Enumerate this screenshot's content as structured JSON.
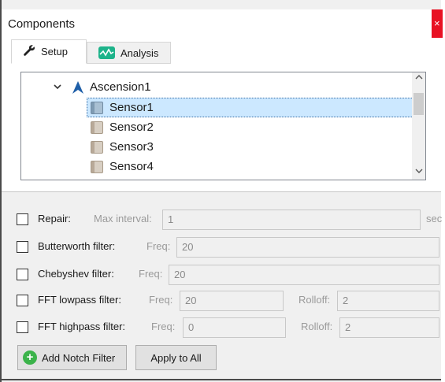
{
  "window": {
    "title": "Components",
    "close_glyph": "×"
  },
  "tabs": [
    {
      "label": "Setup",
      "icon": "wrench-icon",
      "selected": true
    },
    {
      "label": "Analysis",
      "icon": "analysis-chart-icon",
      "selected": false
    }
  ],
  "tree": {
    "root": {
      "label": "Ascension1",
      "expanded": true,
      "icon": "ascension-arrow-icon"
    },
    "items": [
      {
        "label": "Sensor1",
        "selected": true
      },
      {
        "label": "Sensor2",
        "selected": false
      },
      {
        "label": "Sensor3",
        "selected": false
      },
      {
        "label": "Sensor4",
        "selected": false
      }
    ]
  },
  "filters": {
    "repair": {
      "label": "Repair:",
      "field_label": "Max interval:",
      "value": "1",
      "unit": "sec",
      "checked": false
    },
    "butterworth": {
      "label": "Butterworth filter:",
      "field_label": "Freq:",
      "value": "20",
      "checked": false
    },
    "chebyshev": {
      "label": "Chebyshev filter:",
      "field_label": "Freq:",
      "value": "20",
      "checked": false
    },
    "fft_lowpass": {
      "label": "FFT lowpass filter:",
      "field_label": "Freq:",
      "value": "20",
      "rolloff_label": "Rolloff:",
      "rolloff_value": "2",
      "checked": false
    },
    "fft_highpass": {
      "label": "FFT highpass filter:",
      "field_label": "Freq:",
      "value": "0",
      "rolloff_label": "Rolloff:",
      "rolloff_value": "2",
      "checked": false
    }
  },
  "buttons": {
    "add_notch": "Add Notch Filter",
    "apply_all": "Apply to All"
  },
  "colors": {
    "selection": "#cce8ff",
    "close": "#e81123",
    "analysis_icon": "#1db38a",
    "add_icon": "#3bb34a"
  }
}
